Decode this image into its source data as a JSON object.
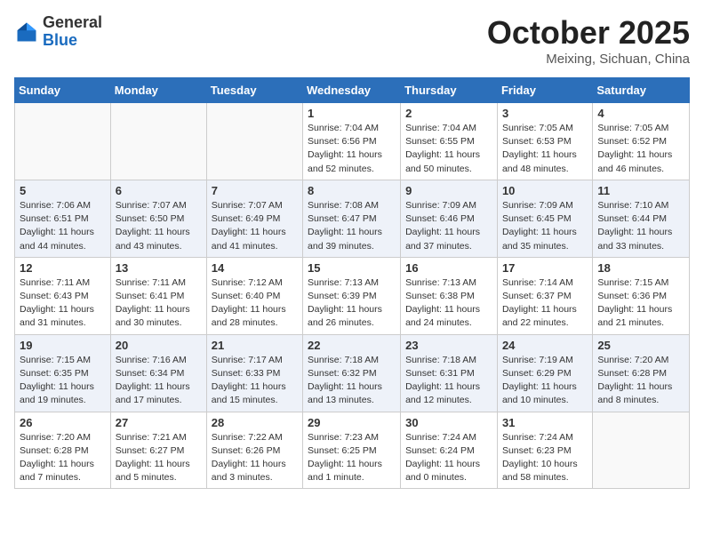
{
  "logo": {
    "general": "General",
    "blue": "Blue"
  },
  "title": "October 2025",
  "subtitle": "Meixing, Sichuan, China",
  "days_of_week": [
    "Sunday",
    "Monday",
    "Tuesday",
    "Wednesday",
    "Thursday",
    "Friday",
    "Saturday"
  ],
  "weeks": [
    [
      {
        "day": "",
        "info": ""
      },
      {
        "day": "",
        "info": ""
      },
      {
        "day": "",
        "info": ""
      },
      {
        "day": "1",
        "info": "Sunrise: 7:04 AM\nSunset: 6:56 PM\nDaylight: 11 hours and 52 minutes."
      },
      {
        "day": "2",
        "info": "Sunrise: 7:04 AM\nSunset: 6:55 PM\nDaylight: 11 hours and 50 minutes."
      },
      {
        "day": "3",
        "info": "Sunrise: 7:05 AM\nSunset: 6:53 PM\nDaylight: 11 hours and 48 minutes."
      },
      {
        "day": "4",
        "info": "Sunrise: 7:05 AM\nSunset: 6:52 PM\nDaylight: 11 hours and 46 minutes."
      }
    ],
    [
      {
        "day": "5",
        "info": "Sunrise: 7:06 AM\nSunset: 6:51 PM\nDaylight: 11 hours and 44 minutes."
      },
      {
        "day": "6",
        "info": "Sunrise: 7:07 AM\nSunset: 6:50 PM\nDaylight: 11 hours and 43 minutes."
      },
      {
        "day": "7",
        "info": "Sunrise: 7:07 AM\nSunset: 6:49 PM\nDaylight: 11 hours and 41 minutes."
      },
      {
        "day": "8",
        "info": "Sunrise: 7:08 AM\nSunset: 6:47 PM\nDaylight: 11 hours and 39 minutes."
      },
      {
        "day": "9",
        "info": "Sunrise: 7:09 AM\nSunset: 6:46 PM\nDaylight: 11 hours and 37 minutes."
      },
      {
        "day": "10",
        "info": "Sunrise: 7:09 AM\nSunset: 6:45 PM\nDaylight: 11 hours and 35 minutes."
      },
      {
        "day": "11",
        "info": "Sunrise: 7:10 AM\nSunset: 6:44 PM\nDaylight: 11 hours and 33 minutes."
      }
    ],
    [
      {
        "day": "12",
        "info": "Sunrise: 7:11 AM\nSunset: 6:43 PM\nDaylight: 11 hours and 31 minutes."
      },
      {
        "day": "13",
        "info": "Sunrise: 7:11 AM\nSunset: 6:41 PM\nDaylight: 11 hours and 30 minutes."
      },
      {
        "day": "14",
        "info": "Sunrise: 7:12 AM\nSunset: 6:40 PM\nDaylight: 11 hours and 28 minutes."
      },
      {
        "day": "15",
        "info": "Sunrise: 7:13 AM\nSunset: 6:39 PM\nDaylight: 11 hours and 26 minutes."
      },
      {
        "day": "16",
        "info": "Sunrise: 7:13 AM\nSunset: 6:38 PM\nDaylight: 11 hours and 24 minutes."
      },
      {
        "day": "17",
        "info": "Sunrise: 7:14 AM\nSunset: 6:37 PM\nDaylight: 11 hours and 22 minutes."
      },
      {
        "day": "18",
        "info": "Sunrise: 7:15 AM\nSunset: 6:36 PM\nDaylight: 11 hours and 21 minutes."
      }
    ],
    [
      {
        "day": "19",
        "info": "Sunrise: 7:15 AM\nSunset: 6:35 PM\nDaylight: 11 hours and 19 minutes."
      },
      {
        "day": "20",
        "info": "Sunrise: 7:16 AM\nSunset: 6:34 PM\nDaylight: 11 hours and 17 minutes."
      },
      {
        "day": "21",
        "info": "Sunrise: 7:17 AM\nSunset: 6:33 PM\nDaylight: 11 hours and 15 minutes."
      },
      {
        "day": "22",
        "info": "Sunrise: 7:18 AM\nSunset: 6:32 PM\nDaylight: 11 hours and 13 minutes."
      },
      {
        "day": "23",
        "info": "Sunrise: 7:18 AM\nSunset: 6:31 PM\nDaylight: 11 hours and 12 minutes."
      },
      {
        "day": "24",
        "info": "Sunrise: 7:19 AM\nSunset: 6:29 PM\nDaylight: 11 hours and 10 minutes."
      },
      {
        "day": "25",
        "info": "Sunrise: 7:20 AM\nSunset: 6:28 PM\nDaylight: 11 hours and 8 minutes."
      }
    ],
    [
      {
        "day": "26",
        "info": "Sunrise: 7:20 AM\nSunset: 6:28 PM\nDaylight: 11 hours and 7 minutes."
      },
      {
        "day": "27",
        "info": "Sunrise: 7:21 AM\nSunset: 6:27 PM\nDaylight: 11 hours and 5 minutes."
      },
      {
        "day": "28",
        "info": "Sunrise: 7:22 AM\nSunset: 6:26 PM\nDaylight: 11 hours and 3 minutes."
      },
      {
        "day": "29",
        "info": "Sunrise: 7:23 AM\nSunset: 6:25 PM\nDaylight: 11 hours and 1 minute."
      },
      {
        "day": "30",
        "info": "Sunrise: 7:24 AM\nSunset: 6:24 PM\nDaylight: 11 hours and 0 minutes."
      },
      {
        "day": "31",
        "info": "Sunrise: 7:24 AM\nSunset: 6:23 PM\nDaylight: 10 hours and 58 minutes."
      },
      {
        "day": "",
        "info": ""
      }
    ]
  ]
}
